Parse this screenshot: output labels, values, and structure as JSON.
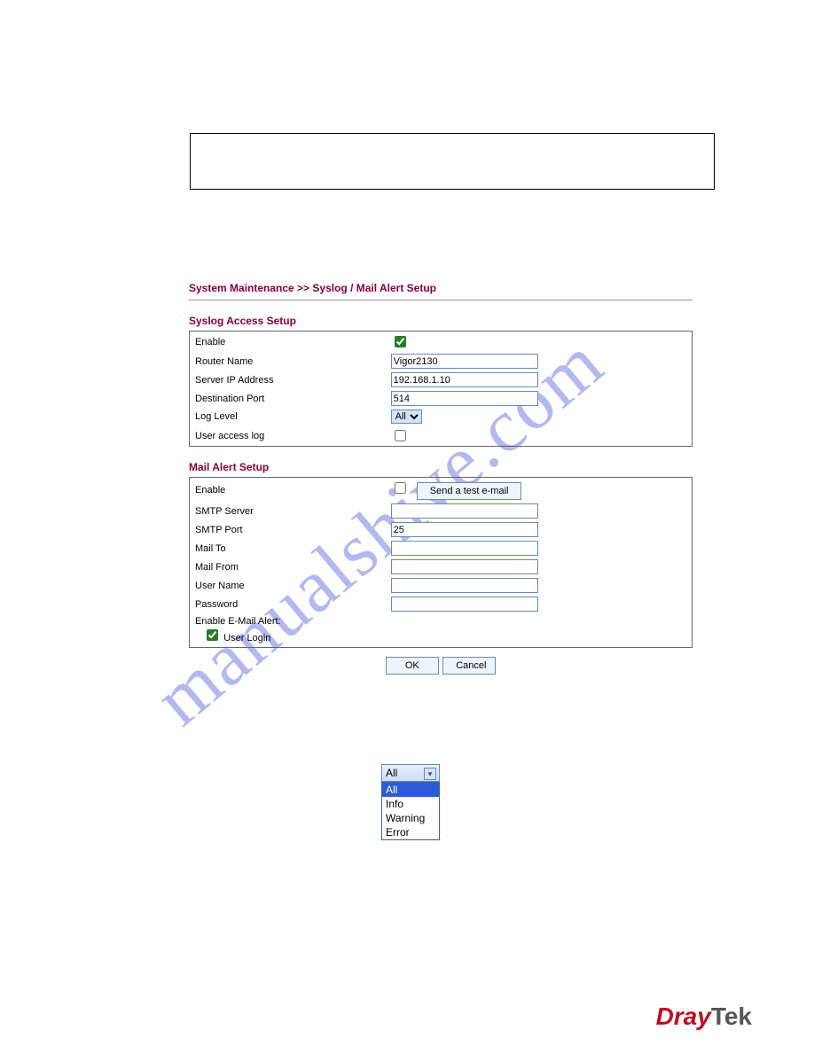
{
  "watermark": "manualshive.com",
  "breadcrumb": "System Maintenance >> Syslog / Mail Alert Setup",
  "syslog": {
    "title": "Syslog Access Setup",
    "rows": {
      "enable_label": "Enable",
      "router_name_label": "Router Name",
      "router_name_value": "Vigor2130",
      "server_ip_label": "Server IP Address",
      "server_ip_value": "192.168.1.10",
      "dest_port_label": "Destination Port",
      "dest_port_value": "514",
      "log_level_label": "Log Level",
      "log_level_value": "All",
      "user_access_label": "User access log"
    }
  },
  "mail": {
    "title": "Mail Alert Setup",
    "rows": {
      "enable_label": "Enable",
      "test_btn": "Send a test e-mail",
      "smtp_server_label": "SMTP Server",
      "smtp_port_label": "SMTP Port",
      "smtp_port_value": "25",
      "mail_to_label": "Mail To",
      "mail_from_label": "Mail From",
      "user_name_label": "User Name",
      "password_label": "Password",
      "enable_alert_label": "Enable E-Mail Alert:",
      "user_login_label": "User Login"
    }
  },
  "buttons": {
    "ok": "OK",
    "cancel": "Cancel"
  },
  "dropdown": {
    "selected": "All",
    "opt0": "All",
    "opt1": "Info",
    "opt2": "Warning",
    "opt3": "Error"
  },
  "brand": {
    "dray": "Dray",
    "tek": "Tek"
  }
}
